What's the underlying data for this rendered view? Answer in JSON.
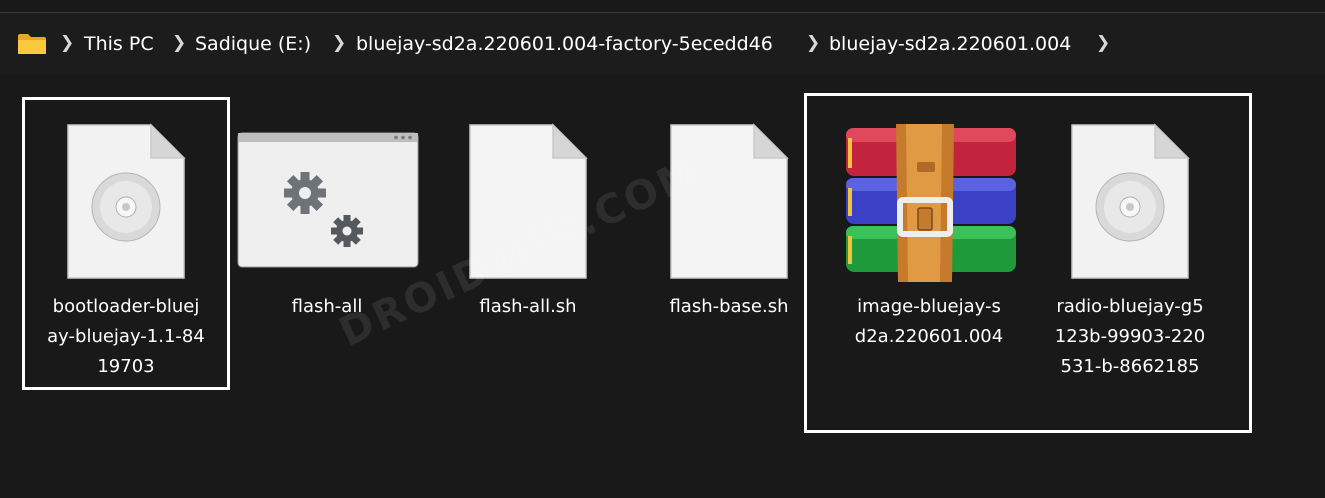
{
  "breadcrumb": {
    "items": [
      "This PC",
      "Sadique (E:)",
      "bluejay-sd2a.220601.004-factory-5ecedd46",
      "bluejay-sd2a.220601.004"
    ],
    "separator": ">"
  },
  "files": [
    {
      "name": "bootloader-bluejay-bluejay-1.1-8419703",
      "lines": [
        "bootloader-bluej",
        "ay-bluejay-1.1-84",
        "19703"
      ],
      "icon": "disc-image-file-icon"
    },
    {
      "name": "flash-all",
      "lines": [
        "flash-all"
      ],
      "icon": "batch-file-settings-icon"
    },
    {
      "name": "flash-all.sh",
      "lines": [
        "flash-all.sh"
      ],
      "icon": "blank-file-icon"
    },
    {
      "name": "flash-base.sh",
      "lines": [
        "flash-base.sh"
      ],
      "icon": "blank-file-icon"
    },
    {
      "name": "image-bluejay-sd2a.220601.004",
      "lines": [
        "image-bluejay-s",
        "d2a.220601.004"
      ],
      "icon": "winrar-archive-icon"
    },
    {
      "name": "radio-bluejay-g5123b-99903-220531-b-8662185",
      "lines": [
        "radio-bluejay-g5",
        "123b-99903-220",
        "531-b-8662185"
      ],
      "icon": "disc-image-file-icon"
    }
  ],
  "watermark": "DROIDWIN.COM",
  "colors": {
    "background": "#191919",
    "highlight_border": "#ffffff",
    "folder": "#f7c33b"
  }
}
